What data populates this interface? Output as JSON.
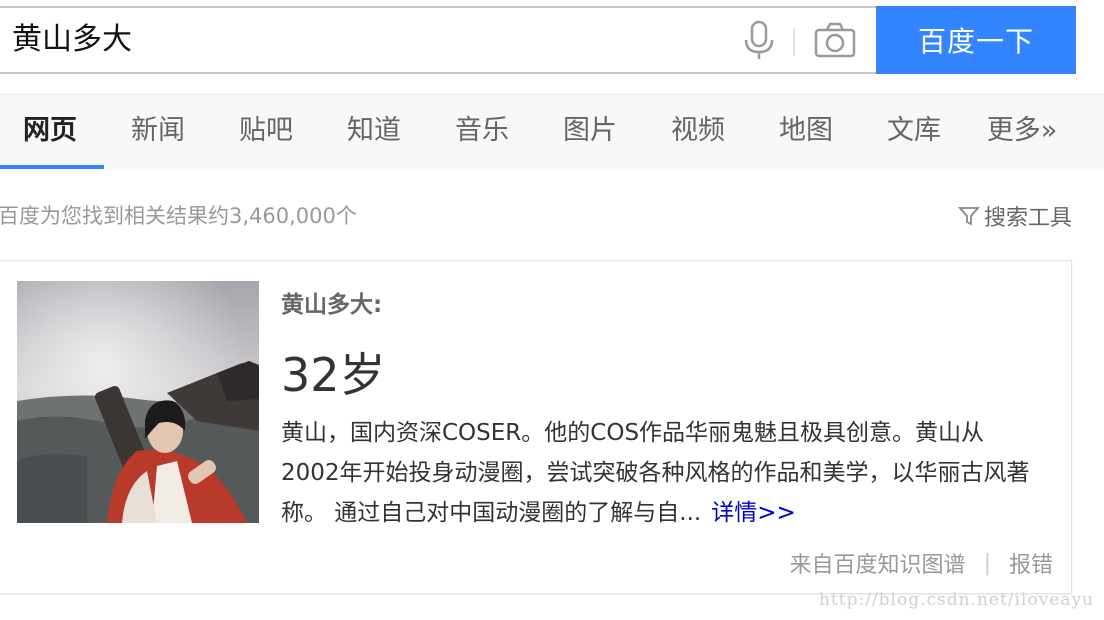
{
  "search": {
    "query": "黄山多大",
    "button_label": "百度一下"
  },
  "tabs": [
    {
      "label": "网页",
      "active": true
    },
    {
      "label": "新闻"
    },
    {
      "label": "贴吧"
    },
    {
      "label": "知道"
    },
    {
      "label": "音乐"
    },
    {
      "label": "图片"
    },
    {
      "label": "视频"
    },
    {
      "label": "地图"
    },
    {
      "label": "文库"
    },
    {
      "label": "更多»"
    }
  ],
  "results": {
    "count_text": "百度为您找到相关结果约3,460,000个",
    "tools_label": "搜索工具"
  },
  "card": {
    "title": "黄山多大:",
    "answer": "32岁",
    "description": "黄山，国内资深COSER。他的COS作品华丽鬼魅且极具创意。黄山从2002年开始投身动漫圈，尝试突破各种风格的作品和美学，以华丽古风著称。 通过自己对中国动漫圈的了解与自...",
    "detail_link": "详情>>",
    "source": "来自百度知识图谱",
    "separator": "|",
    "report": "报错"
  },
  "watermark": "http://blog.csdn.net/iloveayu",
  "colors": {
    "accent": "#3385ff",
    "link": "#0000cc"
  }
}
